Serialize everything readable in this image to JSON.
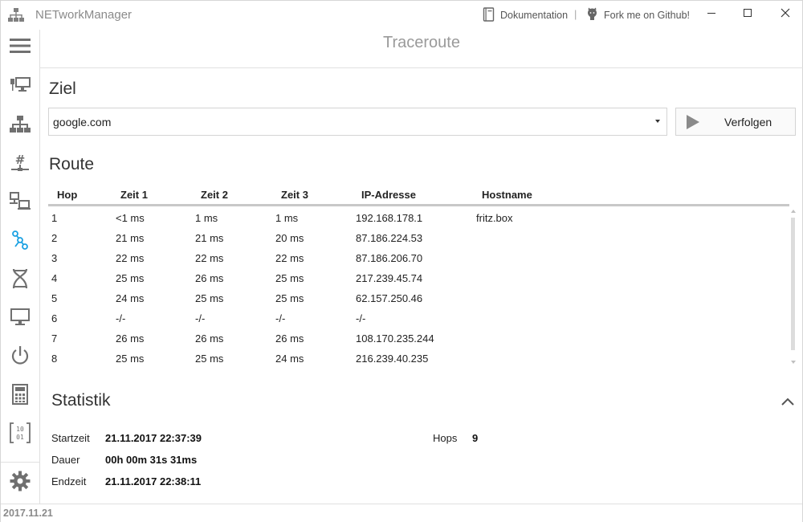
{
  "app": {
    "title": "NETworkManager",
    "doc_link": "Dokumentation",
    "separator": "|",
    "github_link": "Fork me on Github!"
  },
  "sidebar": {
    "items": [
      {
        "icon": "menu-icon"
      },
      {
        "icon": "network-interface-icon"
      },
      {
        "icon": "network-tree-icon"
      },
      {
        "icon": "subnet-hash-icon"
      },
      {
        "icon": "computers-icon"
      },
      {
        "icon": "traceroute-icon",
        "active": true
      },
      {
        "icon": "dna-icon"
      },
      {
        "icon": "monitor-icon"
      },
      {
        "icon": "power-icon"
      },
      {
        "icon": "calculator-icon"
      },
      {
        "icon": "binary-icon"
      },
      {
        "icon": "settings-gear-icon"
      }
    ]
  },
  "header": {
    "title": "Traceroute"
  },
  "target": {
    "title": "Ziel",
    "host_value": "google.com",
    "button_label": "Verfolgen"
  },
  "route": {
    "title": "Route",
    "columns": [
      "Hop",
      "Zeit 1",
      "Zeit 2",
      "Zeit 3",
      "IP-Adresse",
      "Hostname"
    ],
    "rows": [
      [
        "1",
        "<1 ms",
        "1 ms",
        "1 ms",
        "192.168.178.1",
        "fritz.box"
      ],
      [
        "2",
        "21 ms",
        "21 ms",
        "20 ms",
        "87.186.224.53",
        ""
      ],
      [
        "3",
        "22 ms",
        "22 ms",
        "22 ms",
        "87.186.206.70",
        ""
      ],
      [
        "4",
        "25 ms",
        "26 ms",
        "25 ms",
        "217.239.45.74",
        ""
      ],
      [
        "5",
        "24 ms",
        "25 ms",
        "25 ms",
        "62.157.250.46",
        ""
      ],
      [
        "6",
        "-/-",
        "-/-",
        "-/-",
        "-/-",
        ""
      ],
      [
        "7",
        "26 ms",
        "26 ms",
        "26 ms",
        "108.170.235.244",
        ""
      ],
      [
        "8",
        "25 ms",
        "25 ms",
        "24 ms",
        "216.239.40.235",
        ""
      ]
    ]
  },
  "stats": {
    "title": "Statistik",
    "start_label": "Startzeit",
    "start_value": "21.11.2017 22:37:39",
    "duration_label": "Dauer",
    "duration_value": "00h 00m 31s 31ms",
    "end_label": "Endzeit",
    "end_value": "21.11.2017 22:38:11",
    "hops_label": "Hops",
    "hops_value": "9"
  },
  "status_bar": {
    "version": "2017.11.21"
  },
  "colors": {
    "accent": "#1ba1e2",
    "icon_gray": "#707070"
  }
}
